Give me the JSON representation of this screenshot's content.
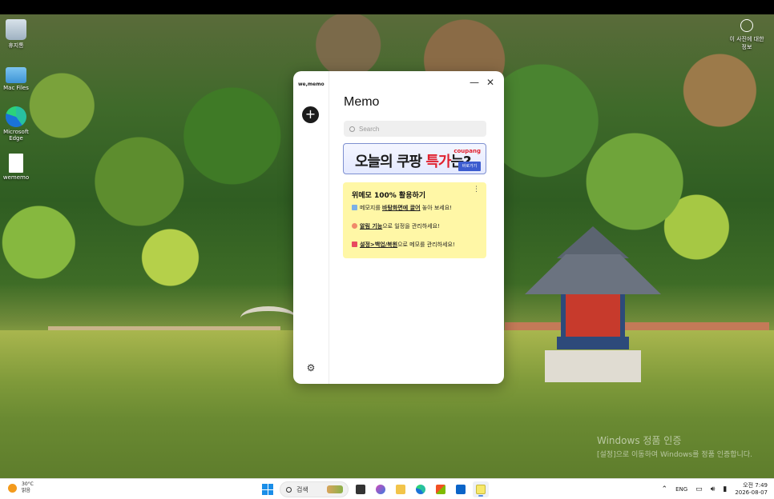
{
  "desktop": {
    "icons": [
      {
        "label": "휴지통"
      },
      {
        "label": "Mac Files"
      },
      {
        "label": "Microsoft Edge"
      },
      {
        "label": "wememo"
      }
    ],
    "top_right_icon": {
      "label": "이 사진에 대한 정보"
    },
    "watermark": {
      "line1": "Windows 정품 인증",
      "line2": "[설정]으로 이동하여 Windows를 정품 인증합니다."
    }
  },
  "memo_app": {
    "brand": "we,memo",
    "title": "Memo",
    "search": {
      "placeholder": "Search"
    },
    "ad": {
      "text_prefix": "오늘의 쿠팡 ",
      "text_highlight": "특가",
      "text_suffix": "는?",
      "logo": "coupang",
      "cta": "바로가기"
    },
    "memo_card": {
      "title": "위메모 100% 활용하기",
      "line1_pre": "메모지를 ",
      "line1_link": "바탕화면에 끌어",
      "line1_post": " 놓아 보세요!",
      "line2_link": "알림 기능",
      "line2_post": "으로 일정을 관리하세요!",
      "line3_link": "설정>백업/복원",
      "line3_post": "으로 메모를 관리하세요!",
      "menu_icon": "more-vertical-icon"
    },
    "add_icon": "plus-icon",
    "settings_icon": "gear-icon",
    "window_controls": {
      "minimize": "—",
      "close": "✕"
    }
  },
  "taskbar": {
    "weather": {
      "temp": "30°C",
      "condition": "맑음"
    },
    "search_label": "검색",
    "language": "ENG",
    "time": "오전 7:49",
    "date": "2026-08-07"
  },
  "colors": {
    "memo_card_bg": "#fff7a6",
    "ad_highlight": "#e0212f",
    "taskbar_bg": "#ffffff"
  }
}
